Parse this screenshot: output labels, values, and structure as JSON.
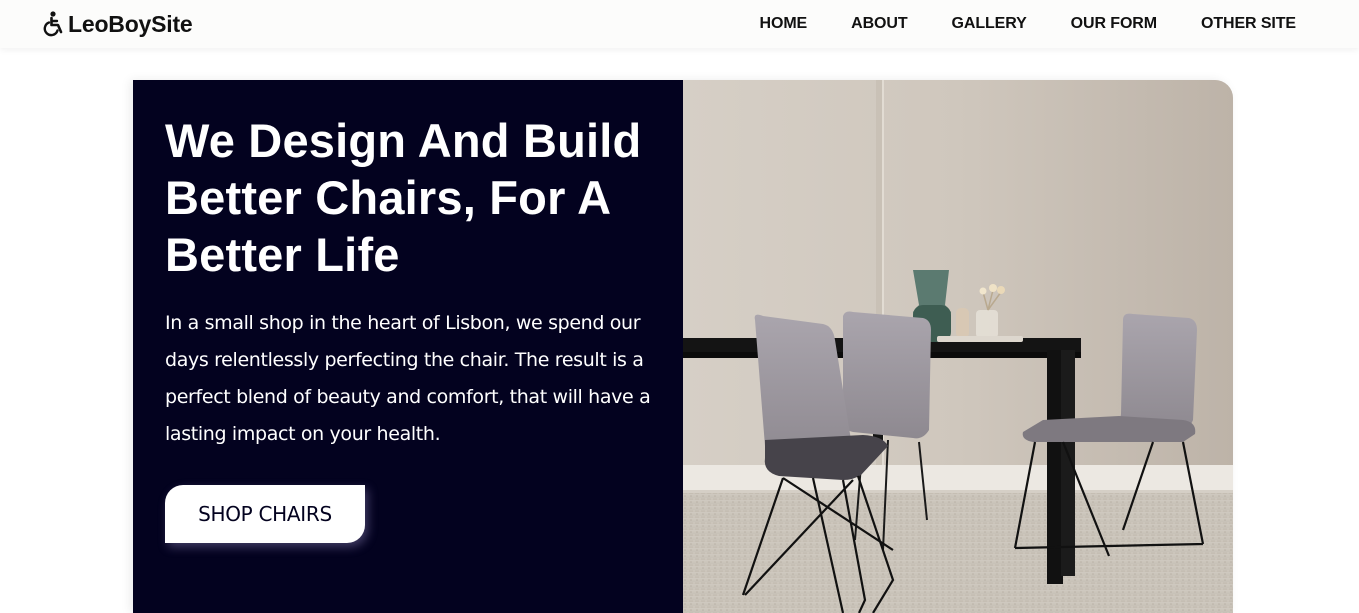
{
  "nav": {
    "brand": "LeoBoySite",
    "brand_icon": "wheelchair-icon",
    "links": [
      "HOME",
      "ABOUT",
      "GALLERY",
      "OUR FORM",
      "OTHER SITE"
    ]
  },
  "hero": {
    "title": "We Design And Build Better Chairs, For A Better Life",
    "body": "In a small shop in the heart of Lisbon, we spend our days relentlessly perfecting the chair. The result is a perfect blend of beauty and comfort, that will have a lasting impact on your health.",
    "button_label": "SHOP CHAIRS",
    "image": "dining-room-chairs-image"
  },
  "colors": {
    "hero_dark": "#03021f",
    "nav_bg": "#fcfcfb",
    "text_dark": "#111111",
    "wall": "#d9d3cb"
  }
}
